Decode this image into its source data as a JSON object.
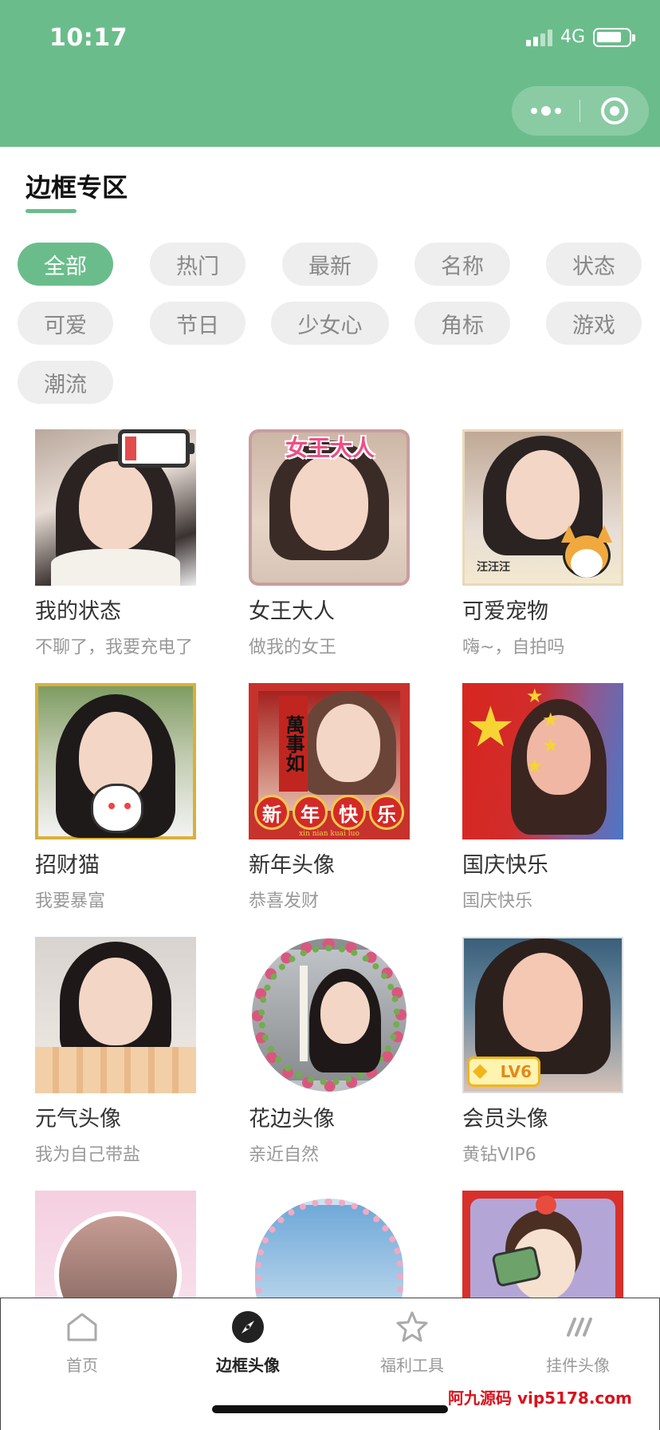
{
  "status_bar": {
    "time": "10:17",
    "network": "4G"
  },
  "section": {
    "title": "边框专区"
  },
  "filters": [
    {
      "label": "全部",
      "active": true
    },
    {
      "label": "热门",
      "active": false
    },
    {
      "label": "最新",
      "active": false
    },
    {
      "label": "名称",
      "active": false
    },
    {
      "label": "状态",
      "active": false
    },
    {
      "label": "可爱",
      "active": false
    },
    {
      "label": "节日",
      "active": false
    },
    {
      "label": "少女心",
      "active": false
    },
    {
      "label": "角标",
      "active": false
    },
    {
      "label": "游戏",
      "active": false
    },
    {
      "label": "潮流",
      "active": false
    }
  ],
  "frames": [
    {
      "name": "我的状态",
      "desc": "不聊了，我要充电了"
    },
    {
      "name": "女王大人",
      "desc": "做我的女王"
    },
    {
      "name": "可爱宠物",
      "desc": "嗨~，自拍吗"
    },
    {
      "name": "招财猫",
      "desc": "我要暴富"
    },
    {
      "name": "新年头像",
      "desc": "恭喜发财"
    },
    {
      "name": "国庆快乐",
      "desc": "国庆快乐"
    },
    {
      "name": "元气头像",
      "desc": "我为自己带盐"
    },
    {
      "name": "花边头像",
      "desc": "亲近自然"
    },
    {
      "name": "会员头像",
      "desc": "黄钻VIP6"
    },
    {
      "name": "",
      "desc": ""
    },
    {
      "name": "",
      "desc": ""
    },
    {
      "name": "",
      "desc": ""
    }
  ],
  "overlays": {
    "queen_text": "女王大人",
    "cny_chars": [
      "新",
      "年",
      "快",
      "乐"
    ],
    "cny_pinyin": "xin nian kuai luo",
    "cny_scroll": "萬事如",
    "vip_badge": "LV6",
    "pet_caption": "汪汪汪"
  },
  "tabs": [
    {
      "label": "首页",
      "icon": "home-icon",
      "active": false
    },
    {
      "label": "边框头像",
      "icon": "compass-icon",
      "active": true
    },
    {
      "label": "福利工具",
      "icon": "star-icon",
      "active": false
    },
    {
      "label": "挂件头像",
      "icon": "slashes-icon",
      "active": false
    }
  ],
  "watermark": "阿九源码 vip5178.com",
  "colors": {
    "brand": "#6abd8b",
    "chip_bg": "#eeeeee",
    "chip_text": "#888888",
    "watermark": "#d9111b"
  }
}
